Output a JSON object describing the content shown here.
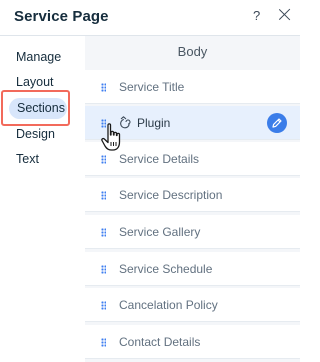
{
  "header": {
    "title": "Service Page",
    "help_label": "?"
  },
  "sidebar": {
    "items": [
      {
        "label": "Manage"
      },
      {
        "label": "Layout"
      },
      {
        "label": "Sections",
        "selected": true
      },
      {
        "label": "Design"
      },
      {
        "label": "Text"
      }
    ]
  },
  "main": {
    "section_label": "Body",
    "rows": [
      {
        "label": "Service Title"
      },
      {
        "label": "Plugin",
        "highlighted": true,
        "icon": "plugin-icon",
        "action_icon": "pencil-icon"
      },
      {
        "label": "Service Details"
      },
      {
        "label": "Service Description"
      },
      {
        "label": "Service Gallery"
      },
      {
        "label": "Service Schedule"
      },
      {
        "label": "Cancelation Policy"
      },
      {
        "label": "Contact Details"
      }
    ]
  },
  "colors": {
    "accent": "#3b7de9",
    "selected_pill": "#d8e6fb",
    "focus_outline": "#f26a5b",
    "highlight_row": "#e7f0fd",
    "panel_bg": "#f4f6f9"
  }
}
